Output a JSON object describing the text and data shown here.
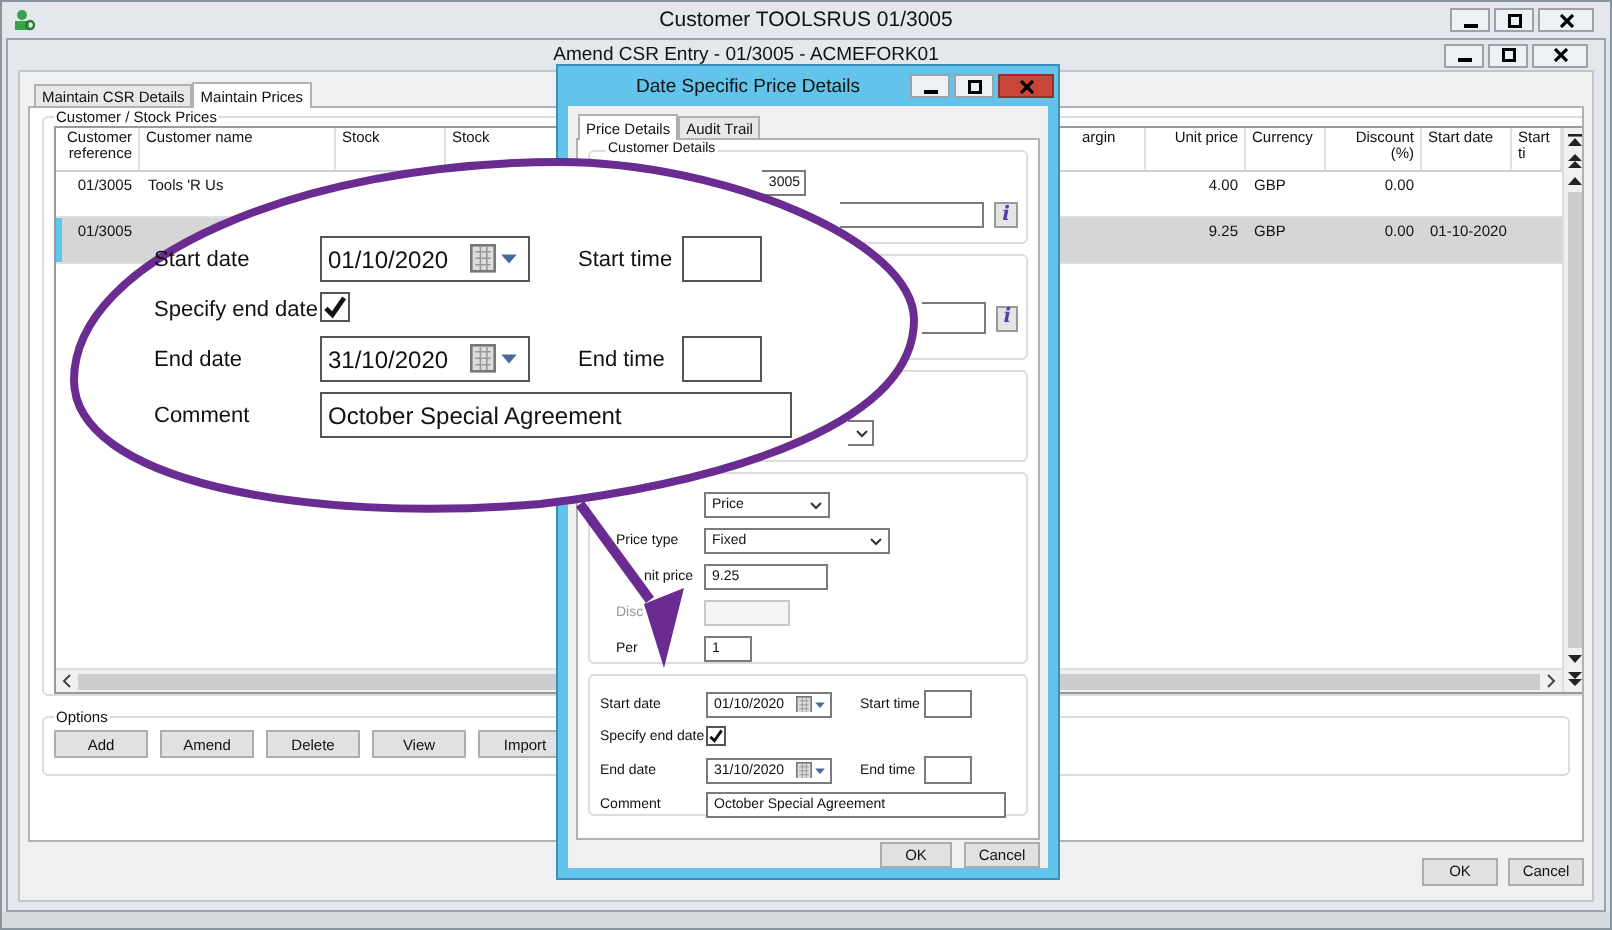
{
  "outer_window": {
    "title": "Customer TOOLSRUS 01/3005"
  },
  "window": {
    "title": "Amend CSR Entry - 01/3005 - ACMEFORK01"
  },
  "tabs": [
    {
      "label": "Maintain CSR Details",
      "selected": false
    },
    {
      "label": "Maintain Prices",
      "selected": true
    }
  ],
  "prices_group": {
    "title": "Customer / Stock Prices",
    "columns": [
      "Customer reference",
      "Customer name",
      "Stock",
      "Stock",
      "argin",
      "Unit price",
      "Currency",
      "Discount (%)",
      "Start date",
      "Start ti"
    ],
    "rows": [
      {
        "ref": "01/3005",
        "name": "Tools 'R Us",
        "unit_price": "4.00",
        "currency": "GBP",
        "discount": "0.00",
        "selected": false
      },
      {
        "ref": "01/3005",
        "unit_price": "9.25",
        "currency": "GBP",
        "discount": "0.00",
        "start_date": "01-10-2020",
        "selected": true
      }
    ]
  },
  "options": {
    "title": "Options",
    "buttons": [
      "Add",
      "Amend",
      "Delete",
      "View",
      "Import"
    ]
  },
  "buttons": [
    "OK",
    "Cancel"
  ],
  "dialog": {
    "title": "Date Specific Price Details",
    "tabs": [
      {
        "label": "Price Details",
        "selected": true
      },
      {
        "label": "Audit Trail",
        "selected": false
      }
    ],
    "customer_details": {
      "title": "Customer Details",
      "customer": "3005",
      "info_button": "i"
    },
    "group_2": {
      "info_button": "i"
    },
    "price": {
      "mode": "Price",
      "price_type_label": "Price type",
      "price_type": "Fixed",
      "unit_price_label": "nit price",
      "unit_price": "9.25",
      "discount_label": "Disc",
      "discount_disabled": true,
      "per_label": "Per",
      "per": "1"
    },
    "dates": {
      "start_date_label": "Start date",
      "start_date": "01/10/2020",
      "start_time_label": "Start time",
      "specify_end_label": "Specify end date",
      "specify_end": true,
      "end_date_label": "End date",
      "end_date": "31/10/2020",
      "end_time_label": "End time",
      "comment_label": "Comment",
      "comment": "October Special Agreement"
    },
    "buttons": [
      "OK",
      "Cancel"
    ]
  },
  "callout": {
    "start_date_label": "Start date",
    "start_date": "01/10/2020",
    "start_time_label": "Start time",
    "specify_end_label": "Specify end date",
    "specify_end": true,
    "end_date_label": "End date",
    "end_date": "31/10/2020",
    "end_time_label": "End time",
    "comment_label": "Comment",
    "comment": "October Special Agreement"
  }
}
